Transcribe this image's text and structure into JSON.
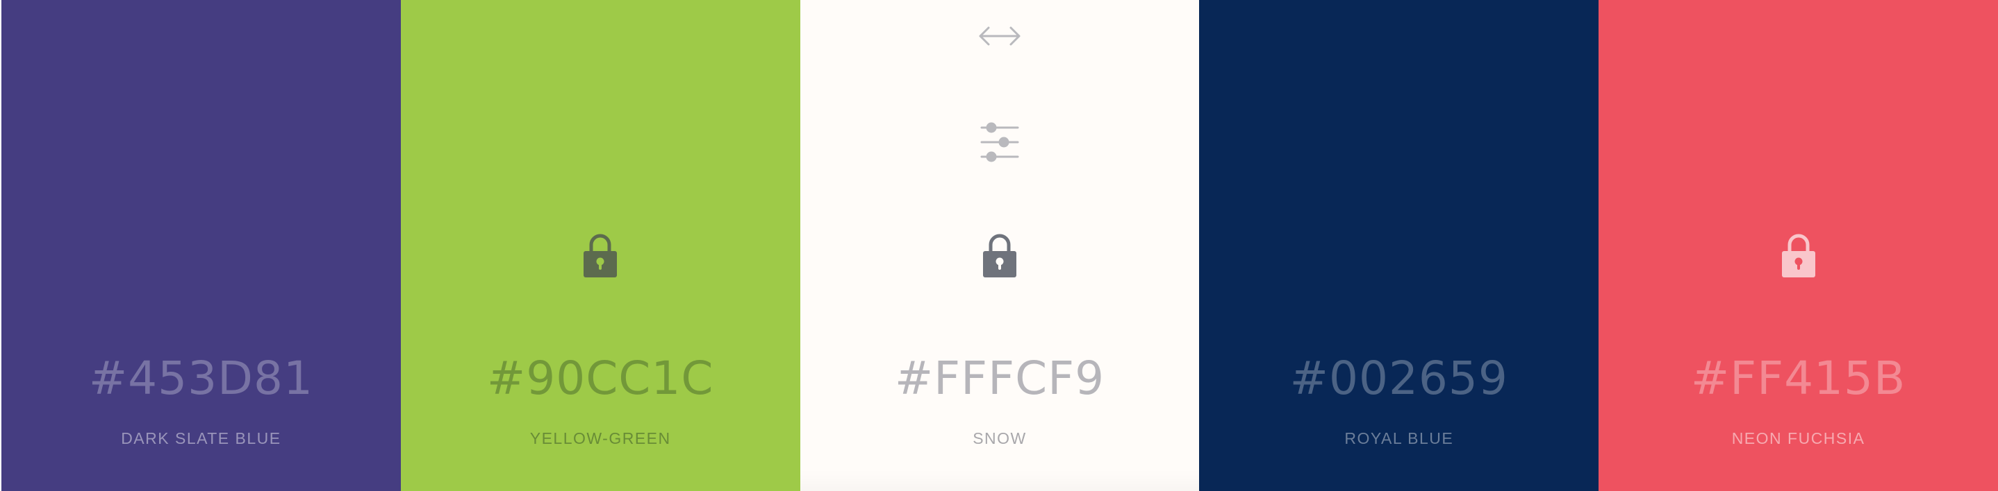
{
  "palette": {
    "swatches": [
      {
        "hex": "#453D81",
        "name": "DARK SLATE BLUE",
        "color": "#453D81",
        "locked": false
      },
      {
        "hex": "#90CC1C",
        "name": "YELLOW-GREEN",
        "color": "#90CC1C",
        "locked": true
      },
      {
        "hex": "#FFFCF9",
        "name": "SNOW",
        "color": "#FFFCF9",
        "locked": true
      },
      {
        "hex": "#002659",
        "name": "ROYAL BLUE",
        "color": "#002659",
        "locked": false
      },
      {
        "hex": "#FF415B",
        "name": "NEON FUCHSIA",
        "color": "#FF415B",
        "locked": true
      }
    ]
  },
  "icons": {
    "drag": "drag-arrows-icon",
    "adjust": "sliders-icon",
    "lock": "lock-icon"
  }
}
